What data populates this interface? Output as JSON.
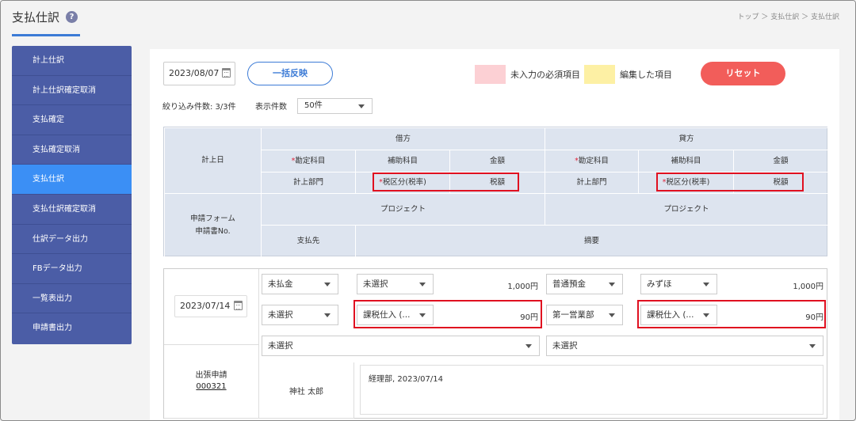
{
  "header": {
    "title": "支払仕訳",
    "help_icon": "?",
    "breadcrumb": "トップ ＞ 支払仕訳 ＞ 支払仕訳"
  },
  "sidebar": {
    "items": [
      {
        "label": "計上仕訳"
      },
      {
        "label": "計上仕訳確定取消"
      },
      {
        "label": "支払確定"
      },
      {
        "label": "支払確定取消"
      },
      {
        "label": "支払仕訳",
        "active": true
      },
      {
        "label": "支払仕訳確定取消"
      },
      {
        "label": "仕訳データ出力"
      },
      {
        "label": "FBデータ出力"
      },
      {
        "label": "一覧表出力"
      },
      {
        "label": "申請書出力"
      }
    ]
  },
  "toolbar": {
    "date": "2023/08/07",
    "bulk_label": "一括反映",
    "legend_required": "未入力の必須項目",
    "legend_edited": "編集した項目",
    "reset_label": "リセット",
    "count_label": "絞り込み件数: 3/3件",
    "perpage_label": "表示件数",
    "perpage_value": "50件",
    "colors": {
      "required": "#fcd0d4",
      "edited": "#fdf0a4",
      "reset": "#f25d5a",
      "accent": "#3c7bd6"
    }
  },
  "table_header": {
    "debit": "借方",
    "credit": "貸方",
    "posting_date": "計上日",
    "req_mark": "*",
    "account": "勘定科目",
    "sub_account": "補助科目",
    "amount": "金額",
    "department": "計上部門",
    "tax_category": "税区分(税率)",
    "tax_amount": "税額",
    "form_label_1": "申請フォーム",
    "form_label_2": "申請書No.",
    "project": "プロジェクト",
    "payee": "支払先",
    "summary": "摘要"
  },
  "row": {
    "date": "2023/07/14",
    "debit_account": "未払金",
    "debit_sub": "未選択",
    "debit_amount": "1,000円",
    "debit_dept": "未選択",
    "debit_tax": "課税仕入 (...",
    "debit_tax_amount": "90円",
    "credit_account": "普通預金",
    "credit_sub": "みずほ",
    "credit_amount": "1,000円",
    "credit_dept": "第一営業部",
    "credit_tax": "課税仕入 (...",
    "credit_tax_amount": "90円",
    "debit_project": "未選択",
    "credit_project": "未選択",
    "form_name": "出張申請",
    "form_no": "000321",
    "payee": "神社 太郎",
    "summary": "経理部, 2023/07/14"
  }
}
